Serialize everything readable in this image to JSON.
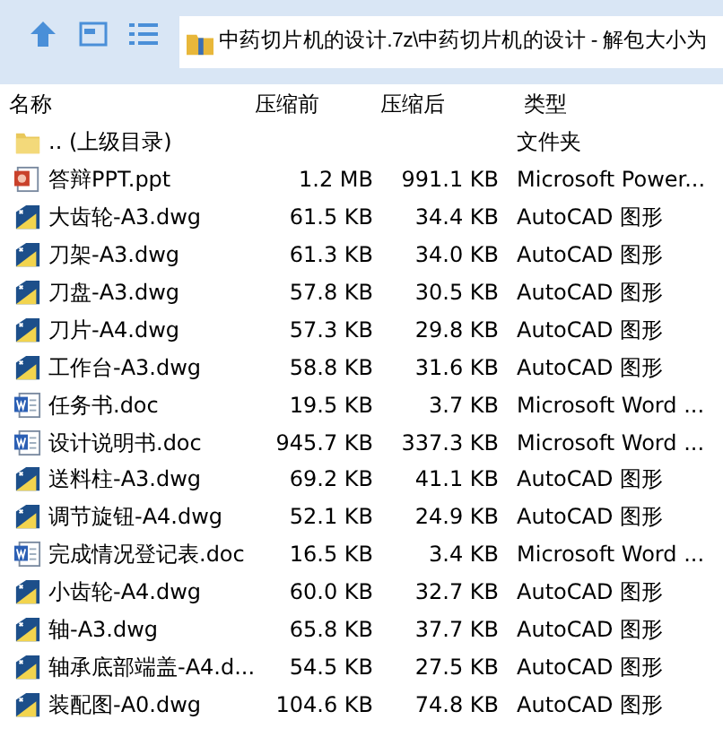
{
  "address_bar": {
    "path": "中药切片机的设计.7z\\中药切片机的设计 - 解包大小为"
  },
  "table": {
    "columns": [
      "名称",
      "压缩前",
      "压缩后",
      "类型"
    ],
    "rows": [
      {
        "kind": "folder",
        "name": ".. (上级目录)",
        "size_before": "",
        "size_after": "",
        "type": "文件夹"
      },
      {
        "kind": "ppt",
        "name": "答辩PPT.ppt",
        "size_before": "1.2 MB",
        "size_after": "991.1 KB",
        "type": "Microsoft Power..."
      },
      {
        "kind": "dwg",
        "name": "大齿轮-A3.dwg",
        "size_before": "61.5 KB",
        "size_after": "34.4 KB",
        "type": "AutoCAD 图形"
      },
      {
        "kind": "dwg",
        "name": "刀架-A3.dwg",
        "size_before": "61.3 KB",
        "size_after": "34.0 KB",
        "type": "AutoCAD 图形"
      },
      {
        "kind": "dwg",
        "name": "刀盘-A3.dwg",
        "size_before": "57.8 KB",
        "size_after": "30.5 KB",
        "type": "AutoCAD 图形"
      },
      {
        "kind": "dwg",
        "name": "刀片-A4.dwg",
        "size_before": "57.3 KB",
        "size_after": "29.8 KB",
        "type": "AutoCAD 图形"
      },
      {
        "kind": "dwg",
        "name": "工作台-A3.dwg",
        "size_before": "58.8 KB",
        "size_after": "31.6 KB",
        "type": "AutoCAD 图形"
      },
      {
        "kind": "doc",
        "name": "任务书.doc",
        "size_before": "19.5 KB",
        "size_after": "3.7 KB",
        "type": "Microsoft Word ..."
      },
      {
        "kind": "doc",
        "name": "设计说明书.doc",
        "size_before": "945.7 KB",
        "size_after": "337.3 KB",
        "type": "Microsoft Word ..."
      },
      {
        "kind": "dwg",
        "name": "送料柱-A3.dwg",
        "size_before": "69.2 KB",
        "size_after": "41.1 KB",
        "type": "AutoCAD 图形"
      },
      {
        "kind": "dwg",
        "name": "调节旋钮-A4.dwg",
        "size_before": "52.1 KB",
        "size_after": "24.9 KB",
        "type": "AutoCAD 图形"
      },
      {
        "kind": "doc",
        "name": "完成情况登记表.doc",
        "size_before": "16.5 KB",
        "size_after": "3.4 KB",
        "type": "Microsoft Word ..."
      },
      {
        "kind": "dwg",
        "name": "小齿轮-A4.dwg",
        "size_before": "60.0 KB",
        "size_after": "32.7 KB",
        "type": "AutoCAD 图形"
      },
      {
        "kind": "dwg",
        "name": "轴-A3.dwg",
        "size_before": "65.8 KB",
        "size_after": "37.7 KB",
        "type": "AutoCAD 图形"
      },
      {
        "kind": "dwg",
        "name": "轴承底部端盖-A4.d...",
        "size_before": "54.5 KB",
        "size_after": "27.5 KB",
        "type": "AutoCAD 图形"
      },
      {
        "kind": "dwg",
        "name": "装配图-A0.dwg",
        "size_before": "104.6 KB",
        "size_after": "74.8 KB",
        "type": "AutoCAD 图形"
      }
    ]
  }
}
